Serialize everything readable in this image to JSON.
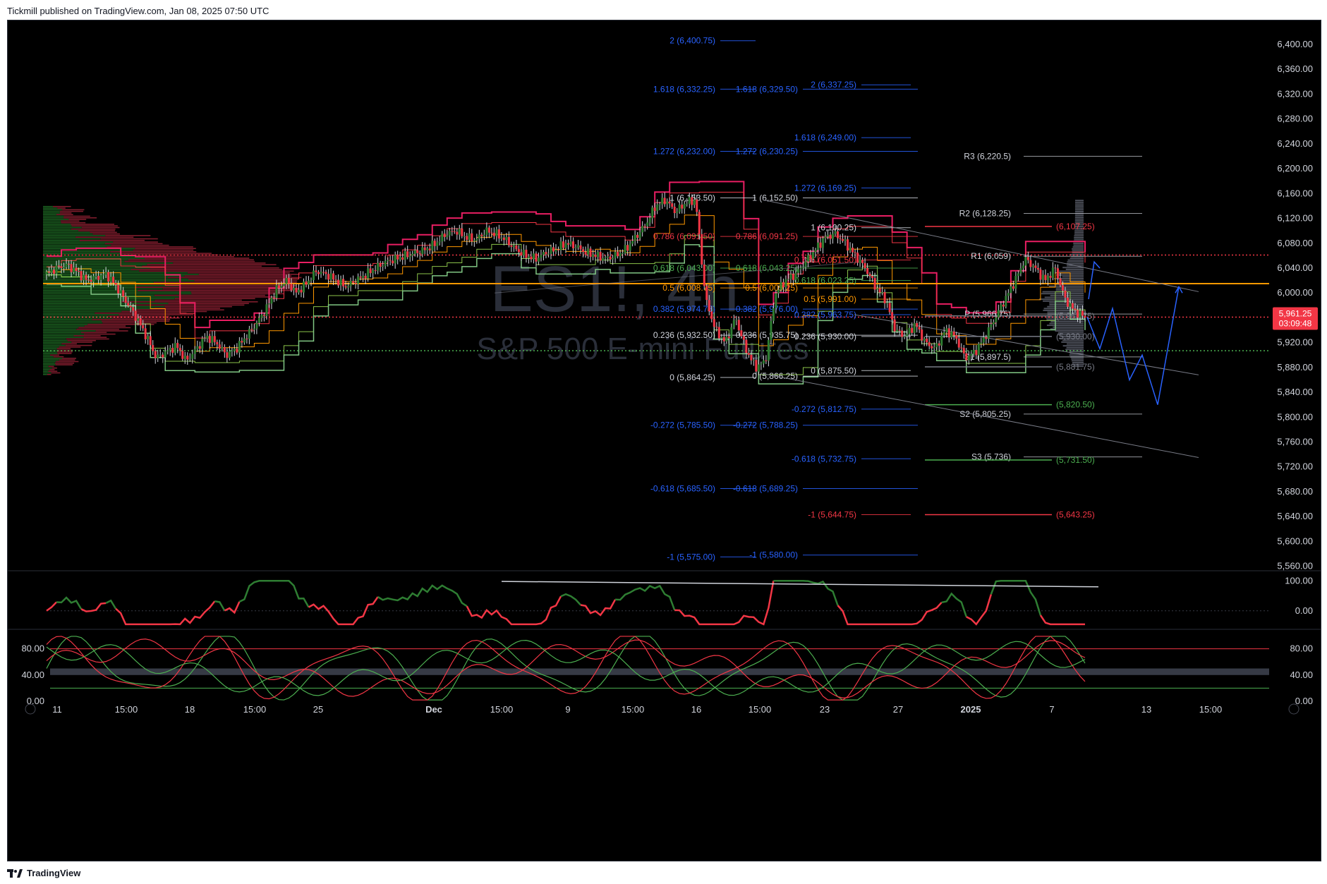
{
  "header": {
    "publisher": "Tickmill published on TradingView.com, Jan 08, 2025 07:50 UTC"
  },
  "footer": {
    "brand": "TradingView"
  },
  "watermark": {
    "symbol": "ES1!, 4h",
    "name": "S&P 500 E-mini Futures"
  },
  "price_badge": {
    "price": "5,961.25",
    "countdown": "03:09:48",
    "color": "#f23645"
  },
  "colors": {
    "up": "#2e7d32",
    "down": "#f23645",
    "fib_blue": "#2962ff",
    "pivot": "#d1d4dc",
    "keltner": "#e91e63",
    "orange": "#ff9800",
    "green_band": "#4caf50"
  },
  "chart_data": [
    {
      "type": "candlestick",
      "title": "",
      "y_ticks": [
        "6,400.00",
        "6,360.00",
        "6,320.00",
        "6,280.00",
        "6,240.00",
        "6,200.00",
        "6,160.00",
        "6,120.00",
        "6,080.00",
        "6,040.00",
        "6,000.00",
        "5,960.00",
        "5,920.00",
        "5,880.00",
        "5,840.00",
        "5,800.00",
        "5,760.00",
        "5,720.00",
        "5,680.00",
        "5,640.00",
        "5,600.00",
        "5,560.00"
      ],
      "ylim": [
        5555,
        6425
      ],
      "x_ticks": [
        "11",
        "15:00",
        "18",
        "15:00",
        "25",
        "Dec",
        "15:00",
        "9",
        "15:00",
        "16",
        "15:00",
        "23",
        "27",
        "2025",
        "7",
        "13",
        "15:00"
      ],
      "price_path": [
        [
          0,
          6030
        ],
        [
          2,
          6040
        ],
        [
          4,
          6045
        ],
        [
          6,
          6035
        ],
        [
          8,
          6020
        ],
        [
          10,
          6025
        ],
        [
          12,
          6030
        ],
        [
          14,
          6010
        ],
        [
          16,
          5985
        ],
        [
          18,
          5960
        ],
        [
          20,
          5930
        ],
        [
          22,
          5895
        ],
        [
          24,
          5905
        ],
        [
          26,
          5915
        ],
        [
          28,
          5890
        ],
        [
          30,
          5910
        ],
        [
          32,
          5930
        ],
        [
          34,
          5920
        ],
        [
          36,
          5900
        ],
        [
          38,
          5910
        ],
        [
          40,
          5930
        ],
        [
          42,
          5950
        ],
        [
          44,
          5975
        ],
        [
          46,
          6005
        ],
        [
          48,
          6020
        ],
        [
          50,
          6000
        ],
        [
          52,
          6015
        ],
        [
          54,
          6035
        ],
        [
          56,
          6030
        ],
        [
          58,
          6020
        ],
        [
          60,
          6010
        ],
        [
          62,
          6020
        ],
        [
          64,
          6030
        ],
        [
          66,
          6040
        ],
        [
          68,
          6050
        ],
        [
          70,
          6055
        ],
        [
          72,
          6060
        ],
        [
          74,
          6065
        ],
        [
          76,
          6070
        ],
        [
          78,
          6080
        ],
        [
          80,
          6095
        ],
        [
          82,
          6100
        ],
        [
          84,
          6090
        ],
        [
          86,
          6085
        ],
        [
          88,
          6100
        ],
        [
          90,
          6095
        ],
        [
          92,
          6085
        ],
        [
          94,
          6070
        ],
        [
          96,
          6060
        ],
        [
          98,
          6055
        ],
        [
          100,
          6065
        ],
        [
          102,
          6070
        ],
        [
          104,
          6080
        ],
        [
          106,
          6075
        ],
        [
          108,
          6065
        ],
        [
          110,
          6060
        ],
        [
          112,
          6055
        ],
        [
          114,
          6060
        ],
        [
          116,
          6070
        ],
        [
          118,
          6090
        ],
        [
          120,
          6110
        ],
        [
          122,
          6140
        ],
        [
          124,
          6150
        ],
        [
          126,
          6130
        ],
        [
          128,
          6145
        ],
        [
          130,
          6150
        ],
        [
          132,
          5990
        ],
        [
          134,
          5940
        ],
        [
          136,
          5920
        ],
        [
          138,
          5960
        ],
        [
          140,
          5910
        ],
        [
          142,
          5880
        ],
        [
          144,
          5890
        ],
        [
          146,
          6000
        ],
        [
          148,
          6020
        ],
        [
          150,
          6030
        ],
        [
          152,
          6050
        ],
        [
          154,
          6070
        ],
        [
          156,
          6090
        ],
        [
          158,
          6095
        ],
        [
          160,
          6080
        ],
        [
          162,
          6060
        ],
        [
          164,
          6040
        ],
        [
          166,
          6010
        ],
        [
          168,
          5990
        ],
        [
          170,
          5940
        ],
        [
          172,
          5930
        ],
        [
          174,
          5950
        ],
        [
          176,
          5920
        ],
        [
          178,
          5910
        ],
        [
          180,
          5940
        ],
        [
          182,
          5930
        ],
        [
          184,
          5895
        ],
        [
          186,
          5905
        ],
        [
          188,
          5930
        ],
        [
          190,
          5960
        ],
        [
          192,
          5990
        ],
        [
          194,
          6020
        ],
        [
          196,
          6055
        ],
        [
          198,
          6040
        ],
        [
          200,
          6020
        ],
        [
          202,
          6040
        ],
        [
          204,
          5990
        ],
        [
          206,
          5970
        ],
        [
          208,
          5961
        ]
      ]
    },
    {
      "type": "line",
      "title": "",
      "y_ticks": [
        "100.00",
        "0.00"
      ],
      "ylim": [
        -50,
        110
      ]
    },
    {
      "type": "line",
      "title": "",
      "y_ticks": [
        "80.00",
        "40.00",
        "0.00"
      ],
      "ylim": [
        0,
        100
      ]
    }
  ],
  "fib_levels": [
    {
      "label": "2 (6,400.75)",
      "price": 6406,
      "color": "#2962ff",
      "side": "a"
    },
    {
      "label": "1.618 (6,332.25)",
      "price": 6328,
      "color": "#2962ff",
      "side": "a"
    },
    {
      "label": "1.618 (6,329.50)",
      "price": 6328,
      "color": "#2962ff",
      "side": "b"
    },
    {
      "label": "2 (6,337.25)",
      "price": 6335,
      "color": "#2962ff",
      "side": "c"
    },
    {
      "label": "1.618 (6,249.00)",
      "price": 6250,
      "color": "#2962ff",
      "side": "c"
    },
    {
      "label": "1.272 (6,232.00)",
      "price": 6228,
      "color": "#2962ff",
      "side": "a"
    },
    {
      "label": "1.272 (6,230.25)",
      "price": 6228,
      "color": "#2962ff",
      "side": "b"
    },
    {
      "label": "1.272 (6,169.25)",
      "price": 6169,
      "color": "#2962ff",
      "side": "c"
    },
    {
      "label": "1 (6,153.50)",
      "price": 6153,
      "color": "#d1d4dc",
      "side": "a"
    },
    {
      "label": "1 (6,152.50)",
      "price": 6153,
      "color": "#d1d4dc",
      "side": "b"
    },
    {
      "label": "1 (6,100.25)",
      "price": 6105,
      "color": "#d1d4dc",
      "side": "c"
    },
    {
      "label": "0.786 (6,091.50)",
      "price": 6091,
      "color": "#f23645",
      "side": "a"
    },
    {
      "label": "0.786 (6,091.25)",
      "price": 6091,
      "color": "#f23645",
      "side": "b"
    },
    {
      "label": "0.786 (6,051.50)",
      "price": 6053,
      "color": "#f23645",
      "side": "c"
    },
    {
      "label": "0.618 (6,043.00)",
      "price": 6040,
      "color": "#4caf50",
      "side": "a"
    },
    {
      "label": "0.618 (6,043.25)",
      "price": 6040,
      "color": "#4caf50",
      "side": "b"
    },
    {
      "label": "0.618 (6,023.25)",
      "price": 6020,
      "color": "#4caf50",
      "side": "c"
    },
    {
      "label": "0.5 (6,008.75)",
      "price": 6008,
      "color": "#ff9800",
      "side": "a"
    },
    {
      "label": "0.5 (6,009.25)",
      "price": 6008,
      "color": "#ff9800",
      "side": "b"
    },
    {
      "label": "0.5 (5,991.00)",
      "price": 5990,
      "color": "#ff9800",
      "side": "c"
    },
    {
      "label": "0.382 (5,974.75)",
      "price": 5974,
      "color": "#2962ff",
      "side": "a"
    },
    {
      "label": "0.382 (5,976.00)",
      "price": 5974,
      "color": "#2962ff",
      "side": "b"
    },
    {
      "label": "0.382 (5,963.75)",
      "price": 5965,
      "color": "#2962ff",
      "side": "c"
    },
    {
      "label": "0.236 (5,932.50)",
      "price": 5932,
      "color": "#d1d4dc",
      "side": "a"
    },
    {
      "label": "0.236 (5,935.75)",
      "price": 5932,
      "color": "#d1d4dc",
      "side": "b"
    },
    {
      "label": "0.236 (5,930.00)",
      "price": 5930,
      "color": "#d1d4dc",
      "side": "c"
    },
    {
      "label": "0 (5,864.25)",
      "price": 5864,
      "color": "#d1d4dc",
      "side": "a"
    },
    {
      "label": "0 (5,866.25)",
      "price": 5866,
      "color": "#d1d4dc",
      "side": "b"
    },
    {
      "label": "0 (5,875.50)",
      "price": 5875,
      "color": "#d1d4dc",
      "side": "c"
    },
    {
      "label": "-0.272 (5,785.50)",
      "price": 5787,
      "color": "#2962ff",
      "side": "a"
    },
    {
      "label": "-0.272 (5,788.25)",
      "price": 5787,
      "color": "#2962ff",
      "side": "b"
    },
    {
      "label": "-0.272 (5,812.75)",
      "price": 5813,
      "color": "#2962ff",
      "side": "c"
    },
    {
      "label": "-0.618 (5,732.75)",
      "price": 5733,
      "color": "#2962ff",
      "side": "c"
    },
    {
      "label": "-0.618 (5,685.50)",
      "price": 5685,
      "color": "#2962ff",
      "side": "a"
    },
    {
      "label": "-0.618 (5,689.25)",
      "price": 5685,
      "color": "#2962ff",
      "side": "b"
    },
    {
      "label": "-1 (5,644.75)",
      "price": 5643,
      "color": "#f23645",
      "side": "c"
    },
    {
      "label": "-1 (5,575.00)",
      "price": 5575,
      "color": "#2962ff",
      "side": "a"
    },
    {
      "label": "-1 (5,580.00)",
      "price": 5578,
      "color": "#2962ff",
      "side": "b"
    }
  ],
  "pivots": [
    {
      "label": "R3 (6,220.5)",
      "price": 6220
    },
    {
      "label": "R2 (6,128.25)",
      "price": 6128
    },
    {
      "label": "R1 (6,059)",
      "price": 6059
    },
    {
      "label": "P (5,966.75)",
      "price": 5966
    },
    {
      "label": "S1 (5,897.5)",
      "price": 5897
    },
    {
      "label": "S2 (5,805.25)",
      "price": 5805
    },
    {
      "label": "S3 (5,736)",
      "price": 5736
    }
  ],
  "right_levels": [
    {
      "label": "(6,107.25)",
      "price": 6107,
      "color": "#f23645"
    },
    {
      "label": "(5,963.75)",
      "price": 5963,
      "color": "#787b86"
    },
    {
      "label": "(5,930.00)",
      "price": 5930,
      "color": "#787b86"
    },
    {
      "label": "(5,881.75)",
      "price": 5881,
      "color": "#787b86"
    },
    {
      "label": "(5,820.50)",
      "price": 5820,
      "color": "#4caf50"
    },
    {
      "label": "(5,731.50)",
      "price": 5731,
      "color": "#4caf50"
    },
    {
      "label": "(5,643.25)",
      "price": 5643,
      "color": "#f23645"
    }
  ],
  "horizontal_lines": [
    {
      "price": 6015,
      "color": "#ff9800",
      "style": "solid"
    },
    {
      "price": 6061,
      "color": "#f23645",
      "style": "dotted"
    },
    {
      "price": 5961,
      "color": "#f23645",
      "style": "dotted"
    },
    {
      "price": 5907,
      "color": "#4caf50",
      "style": "dotted"
    }
  ]
}
